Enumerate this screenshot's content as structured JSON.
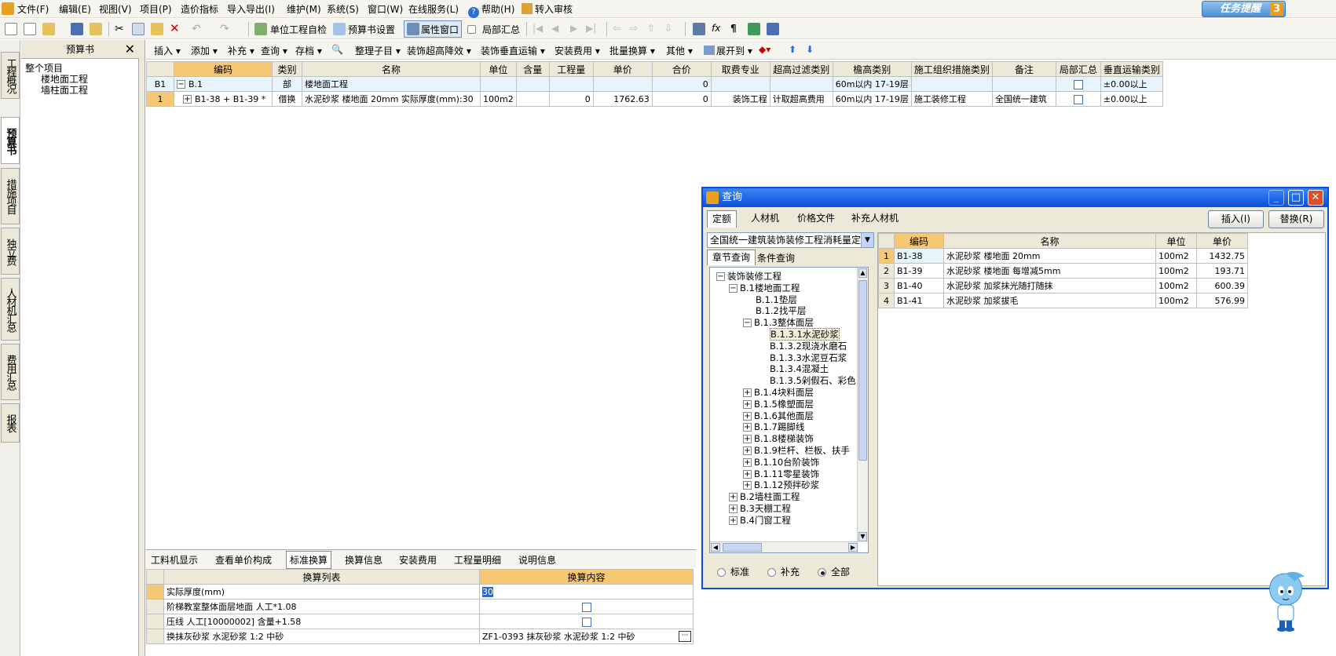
{
  "menu": {
    "items": [
      "文件(F)",
      "编辑(E)",
      "视图(V)",
      "项目(P)",
      "造价指标",
      "导入导出(I)",
      "维护(M)",
      "系统(S)",
      "窗口(W)",
      "在线服务(L)",
      "帮助(H)",
      "转入审核"
    ],
    "reminder": "任务提醒",
    "reminder_count": "3"
  },
  "toolbar1": {
    "unit_check": "单位工程自检",
    "budget_settings": "预算书设置",
    "property_window": "属性窗口",
    "partial_summary": "局部汇总"
  },
  "vtabs": [
    "工程概况",
    "预算书",
    "措施项目",
    "独立费",
    "人材机汇总",
    "费用汇总",
    "报表"
  ],
  "left_panel": {
    "header": "预算书",
    "tree": [
      "整个项目",
      "楼地面工程",
      "墙柱面工程"
    ]
  },
  "toolbar2": [
    "插入",
    "添加",
    "补充",
    "查询",
    "存档",
    "整理子目",
    "装饰超高降效",
    "装饰垂直运输",
    "安装费用",
    "批量换算",
    "其他",
    "展开到"
  ],
  "grid": {
    "headers": [
      "编码",
      "类别",
      "名称",
      "单位",
      "含量",
      "工程量",
      "单价",
      "合价",
      "取费专业",
      "超高过滤类别",
      "檐高类别",
      "施工组织措施类别",
      "备注",
      "局部汇总",
      "垂直运输类别"
    ],
    "rows": [
      {
        "num": "B1",
        "code": "B.1",
        "type": "部",
        "name": "楼地面工程",
        "unit": "",
        "content": "",
        "qty": "",
        "price": "",
        "total": "0",
        "fee": "",
        "overheight": "",
        "eaves": "60m以内 17-19层",
        "org": "",
        "note": "",
        "vertical": "±0.00以上"
      },
      {
        "num": "1",
        "code": "B1-38 + B1-39 *",
        "type": "借换",
        "name": "水泥砂浆 楼地面 20mm 实际厚度(mm):30",
        "unit": "100m2",
        "content": "",
        "qty": "0",
        "price": "1762.63",
        "total": "0",
        "fee": "装饰工程",
        "overheight": "计取超高费用",
        "eaves": "60m以内 17-19层",
        "org": "施工装修工程",
        "note": "全国统一建筑",
        "vertical": "±0.00以上"
      }
    ]
  },
  "bottom_tabs": [
    "工料机显示",
    "查看单价构成",
    "标准换算",
    "换算信息",
    "安装费用",
    "工程量明细",
    "说明信息"
  ],
  "conversion": {
    "headers": [
      "换算列表",
      "换算内容"
    ],
    "rows": [
      {
        "label": "实际厚度(mm)",
        "value": "30"
      },
      {
        "label": "阶梯教室整体面层地面 人工*1.08",
        "value": ""
      },
      {
        "label": "压线 人工[10000002] 含量+1.58",
        "value": ""
      },
      {
        "label": "换抹灰砂浆 水泥砂浆 1:2 中砂",
        "value": "ZF1-0393  抹灰砂浆 水泥砂浆 1:2 中砂"
      }
    ]
  },
  "dialog": {
    "title": "查询",
    "tabs": [
      "定额",
      "人材机",
      "价格文件",
      "补充人材机"
    ],
    "insert_btn": "插入(I)",
    "replace_btn": "替换(R)",
    "combo": "全国统一建筑装饰装修工程消耗量定",
    "subtabs": [
      "章节查询",
      "条件查询"
    ],
    "tree": [
      {
        "label": "装饰装修工程",
        "indent": 0,
        "exp": "−"
      },
      {
        "label": "B.1楼地面工程",
        "indent": 1,
        "exp": "−"
      },
      {
        "label": "B.1.1垫层",
        "indent": 2,
        "exp": ""
      },
      {
        "label": "B.1.2找平层",
        "indent": 2,
        "exp": ""
      },
      {
        "label": "B.1.3整体面层",
        "indent": 2,
        "exp": "−"
      },
      {
        "label": "B.1.3.1水泥砂浆",
        "indent": 3,
        "exp": ""
      },
      {
        "label": "B.1.3.2现浇水磨石",
        "indent": 3,
        "exp": ""
      },
      {
        "label": "B.1.3.3水泥豆石浆",
        "indent": 3,
        "exp": ""
      },
      {
        "label": "B.1.3.4混凝土",
        "indent": 3,
        "exp": ""
      },
      {
        "label": "B.1.3.5剁假石、彩色",
        "indent": 3,
        "exp": ""
      },
      {
        "label": "B.1.4块料面层",
        "indent": 2,
        "exp": "+"
      },
      {
        "label": "B.1.5橡塑面层",
        "indent": 2,
        "exp": "+"
      },
      {
        "label": "B.1.6其他面层",
        "indent": 2,
        "exp": "+"
      },
      {
        "label": "B.1.7踢脚线",
        "indent": 2,
        "exp": "+"
      },
      {
        "label": "B.1.8楼梯装饰",
        "indent": 2,
        "exp": "+"
      },
      {
        "label": "B.1.9栏杆、栏板、扶手",
        "indent": 2,
        "exp": "+"
      },
      {
        "label": "B.1.10台阶装饰",
        "indent": 2,
        "exp": "+"
      },
      {
        "label": "B.1.11零星装饰",
        "indent": 2,
        "exp": "+"
      },
      {
        "label": "B.1.12预拌砂浆",
        "indent": 2,
        "exp": "+"
      },
      {
        "label": "B.2墙柱面工程",
        "indent": 1,
        "exp": "+"
      },
      {
        "label": "B.3天棚工程",
        "indent": 1,
        "exp": "+"
      },
      {
        "label": "B.4门窗工程",
        "indent": 1,
        "exp": "+"
      }
    ],
    "radios": [
      "标准",
      "补充",
      "全部"
    ],
    "result_headers": [
      "编码",
      "名称",
      "单位",
      "单价"
    ],
    "results": [
      {
        "num": "1",
        "code": "B1-38",
        "name": "水泥砂浆 楼地面 20mm",
        "unit": "100m2",
        "price": "1432.75"
      },
      {
        "num": "2",
        "code": "B1-39",
        "name": "水泥砂浆 楼地面 每增减5mm",
        "unit": "100m2",
        "price": "193.71"
      },
      {
        "num": "3",
        "code": "B1-40",
        "name": "水泥砂浆 加浆抹光随打随抹",
        "unit": "100m2",
        "price": "600.39"
      },
      {
        "num": "4",
        "code": "B1-41",
        "name": "水泥砂浆 加浆拔毛",
        "unit": "100m2",
        "price": "576.99"
      }
    ]
  }
}
